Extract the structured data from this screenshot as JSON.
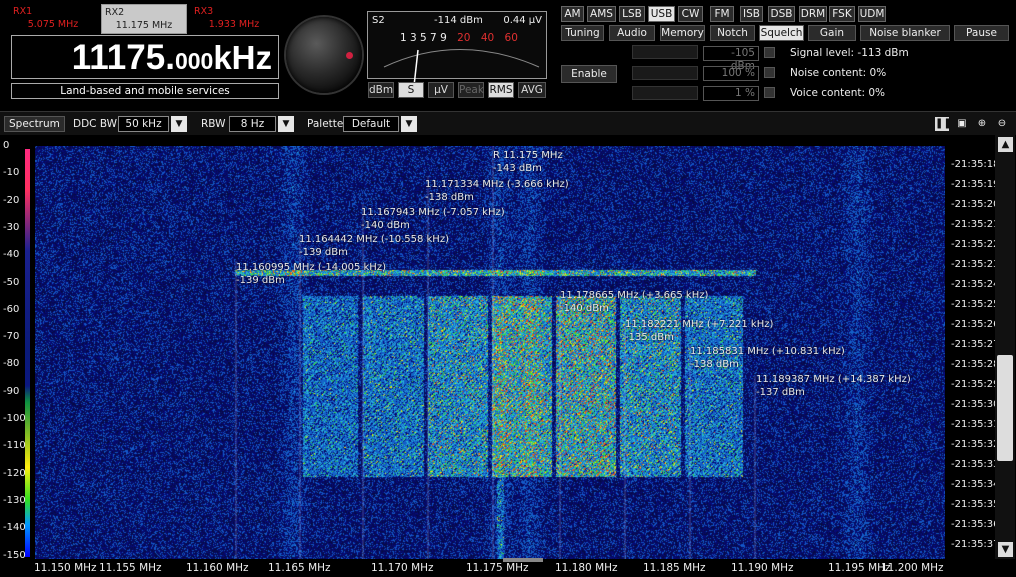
{
  "receivers": [
    {
      "name": "RX1",
      "freq": "5.075 MHz"
    },
    {
      "name": "RX2",
      "freq": "11.175 MHz"
    },
    {
      "name": "RX3",
      "freq": "1.933 MHz"
    }
  ],
  "frequency": {
    "main": "11175.",
    "fraction": "000",
    "unit": "kHz"
  },
  "service": "Land-based and mobile services",
  "smeter": {
    "s_label": "S2",
    "dbm": "-114 dBm",
    "uv": "0.44 μV",
    "scale_white": "1 3 5 7 9",
    "scale_red": [
      "20",
      "40",
      "60"
    ],
    "buttons": [
      "dBm",
      "S",
      "μV",
      "Peak",
      "RMS",
      "AVG"
    ]
  },
  "modes": [
    "AM",
    "AMS",
    "LSB",
    "USB",
    "CW",
    "FM",
    "ISB",
    "DSB",
    "DRM",
    "FSK",
    "UDM"
  ],
  "mode_selected": "USB",
  "functions": [
    "Tuning",
    "Audio",
    "Memory",
    "Notch",
    "Squelch",
    "Gain",
    "Noise blanker",
    "Pause"
  ],
  "function_selected": "Squelch",
  "squelch": {
    "enable": "Enable",
    "level": "-105 dBm",
    "noise": "100 %",
    "voice": "1 %",
    "signal_level": "Signal level: -113 dBm",
    "noise_content": "Noise content: 0%",
    "voice_content": "Voice content: 0%"
  },
  "toolbar": {
    "spectrum": "Spectrum",
    "ddc_label": "DDC BW",
    "ddc_value": "50 kHz",
    "rbw_label": "RBW",
    "rbw_value": "8 Hz",
    "palette_label": "Palette",
    "palette_value": "Default"
  },
  "yaxis": [
    "0",
    "-10",
    "-20",
    "-30",
    "-40",
    "-50",
    "-60",
    "-70",
    "-80",
    "-90",
    "-100",
    "-110",
    "-120",
    "-130",
    "-140",
    "-150"
  ],
  "times": [
    "-21:35:18",
    "-21:35:19",
    "-21:35:20",
    "-21:35:21",
    "-21:35:22",
    "-21:35:23",
    "-21:35:24",
    "-21:35:25",
    "-21:35:26",
    "-21:35:27",
    "-21:35:28",
    "-21:35:29",
    "-21:35:30",
    "-21:35:31",
    "-21:35:32",
    "-21:35:33",
    "-21:35:34",
    "-21:35:35",
    "-21:35:36",
    "-21:35:37"
  ],
  "xaxis": [
    "11.150 MHz",
    "11.155 MHz",
    "11.160 MHz",
    "11.165 MHz",
    "11.170 MHz",
    "11.175 MHz",
    "11.180 MHz",
    "11.185 MHz",
    "11.190 MHz",
    "11.195 MHz",
    "11.200 MHz"
  ],
  "markers": [
    {
      "freq": "R 11.175 MHz",
      "level": "-143 dBm"
    },
    {
      "freq": "11.171334 MHz (-3.666 kHz)",
      "level": "-138 dBm"
    },
    {
      "freq": "11.167943 MHz (-7.057 kHz)",
      "level": "-140 dBm"
    },
    {
      "freq": "11.164442 MHz (-10.558 kHz)",
      "level": "-139 dBm"
    },
    {
      "freq": "11.160995 MHz (-14.005 kHz)",
      "level": "-139 dBm"
    },
    {
      "freq": "11.178665 MHz (+3.665 kHz)",
      "level": "-140 dBm"
    },
    {
      "freq": "11.182221 MHz (+7.221 kHz)",
      "level": "-135 dBm"
    },
    {
      "freq": "11.185831 MHz (+10.831 kHz)",
      "level": "-138 dBm"
    },
    {
      "freq": "11.189387 MHz (+14.387 kHz)",
      "level": "-137 dBm"
    }
  ]
}
